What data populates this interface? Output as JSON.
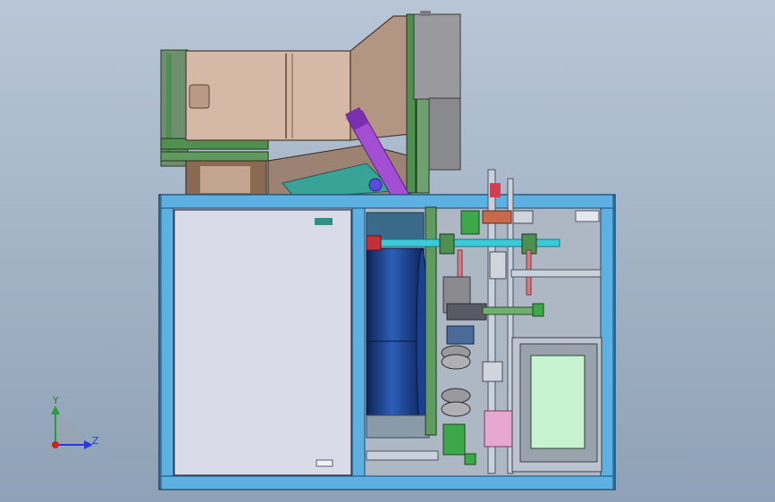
{
  "axes": {
    "y_label": "Y",
    "z_label": "Z"
  },
  "colors": {
    "background_top": "#b8c6d6",
    "background_bottom": "#8fa1b6",
    "frame_blue": "#3f9ed8",
    "panel_light": "#d9dbe9",
    "hopper_tan": "#d6b8a6",
    "hopper_dark": "#b39584",
    "chute_purple": "#a24fd4",
    "rail_green": "#4f8f4f",
    "drum_navy": "#13326e",
    "cyan_shaft": "#3cc9d8",
    "red_part": "#c2303a",
    "pink_rod": "#d27c86",
    "screen_green": "#c8f3d0",
    "teal_badge": "#2f8f86"
  }
}
